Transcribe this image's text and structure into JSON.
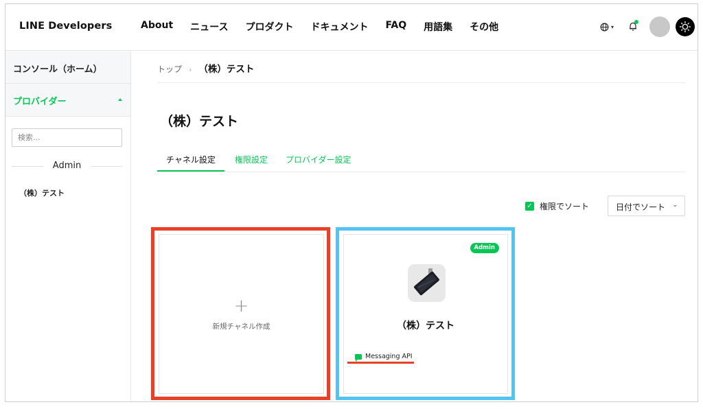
{
  "header": {
    "brand": "LINE Developers",
    "nav": [
      "About",
      "ニュース",
      "プロダクト",
      "ドキュメント",
      "FAQ",
      "用語集",
      "その他"
    ],
    "icons": [
      "globe-icon",
      "bell-icon",
      "sun-icon"
    ]
  },
  "sidebar": {
    "home": "コンソール（ホーム）",
    "provider": "プロバイダー",
    "search_placeholder": "検索...",
    "group_label": "Admin",
    "company": "（株）テスト"
  },
  "main": {
    "breadcrumb": {
      "top": "トップ",
      "separator": "›",
      "current": "（株）テスト"
    },
    "title": "（株）テスト",
    "tabs": [
      "チャネル設定",
      "権限設定",
      "プロバイダー設定"
    ],
    "sort_checkbox_label": "権限でソート",
    "sort_select_value": "日付でソート",
    "new_card": {
      "plus": "+",
      "label": "新規チャネル作成"
    },
    "channel_card": {
      "badge": "Admin",
      "name": "（株）テスト",
      "type": "Messaging API"
    }
  },
  "colors": {
    "accent": "#06c755",
    "highlight_red": "#e84128",
    "highlight_blue": "#53c3f1"
  }
}
